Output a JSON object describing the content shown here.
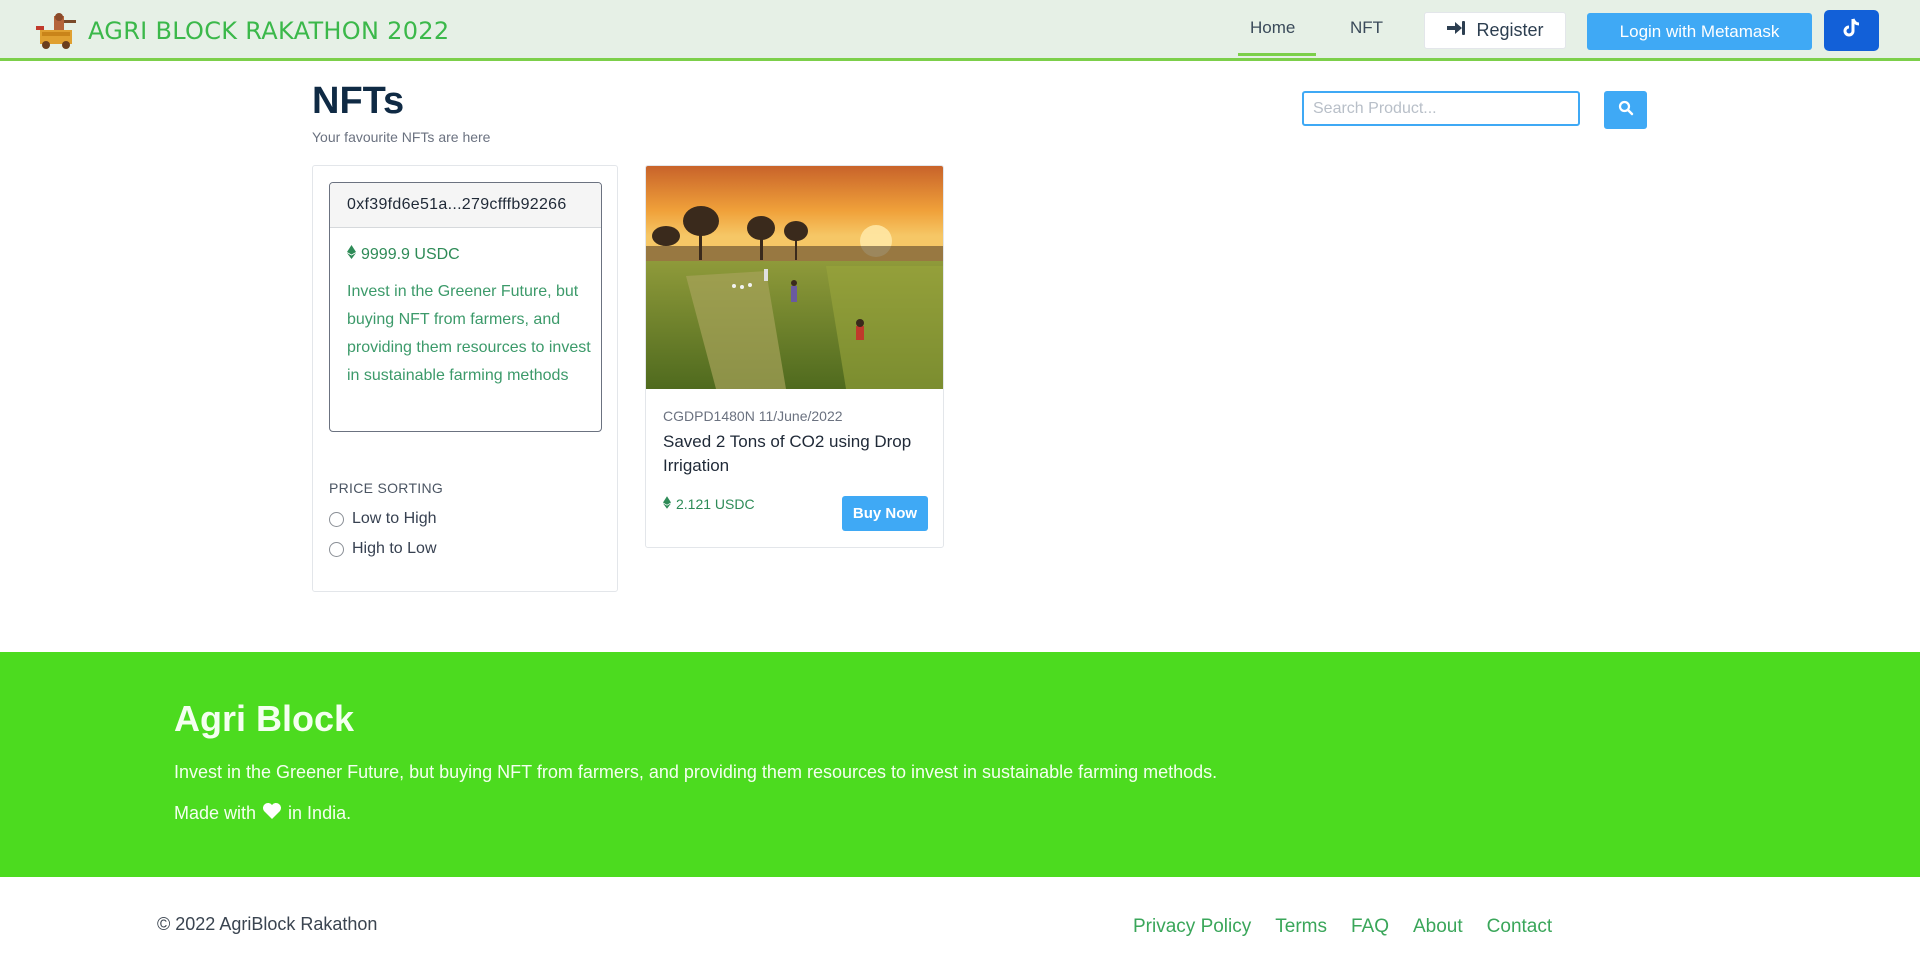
{
  "header": {
    "brand": "AGRI BLOCK RAKATHON 2022",
    "nav": {
      "home": "Home",
      "nft": "NFT"
    },
    "register_label": "Register",
    "login_label": "Login with Metamask"
  },
  "main": {
    "title": "NFTs",
    "subtitle": "Your favourite NFTs are here",
    "search": {
      "placeholder": "Search Product..."
    },
    "sidebar": {
      "address": "0xf39fd6e51a...279cfffb92266",
      "price": "9999.9 USDC",
      "description": "Invest in the Greener Future, but buying NFT from farmers, and providing them resources to invest in sustainable farming methods",
      "sort_title": "PRICE SORTING",
      "sort_options": [
        "Low to High",
        "High to Low"
      ]
    },
    "products": [
      {
        "meta": "CGDPD1480N 11/June/2022",
        "title": "Saved 2 Tons of CO2 using Drop Irrigation",
        "price": "2.121 USDC",
        "buy_label": "Buy Now"
      }
    ]
  },
  "footer": {
    "title": "Agri Block",
    "description": "Invest in the Greener Future, but buying NFT from farmers, and providing them resources to invest in sustainable farming methods.",
    "made_prefix": "Made with",
    "made_suffix": "in India.",
    "copyright": "© 2022 AgriBlock Rakathon",
    "links": [
      "Privacy Policy",
      "Terms",
      "FAQ",
      "About",
      "Contact"
    ]
  },
  "colors": {
    "accent": "#3fa9f5",
    "footer_green": "#4cdb1f",
    "brand_green": "#3bb84a",
    "price_green": "#2e8b57"
  },
  "icons": {
    "brand_logo": "farmer-cart-icon",
    "register": "sign-in-icon",
    "tiktok": "tiktok-icon",
    "search": "search-icon",
    "currency": "ethereum-icon",
    "heart": "heart-icon"
  }
}
